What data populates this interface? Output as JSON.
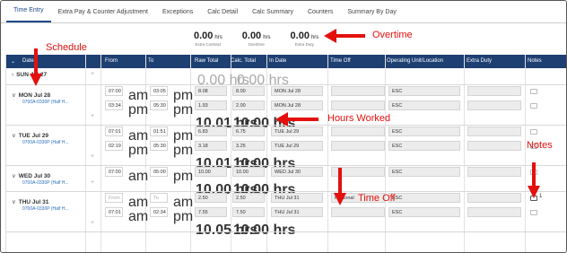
{
  "tabs": [
    "Time Entry",
    "Extra Pay & Counter Adjustment",
    "Exceptions",
    "Calc Detail",
    "Calc Summary",
    "Counters",
    "Summary By Day"
  ],
  "summary": [
    {
      "value": "0.00",
      "unit": "hrs",
      "label": "Extra Contract"
    },
    {
      "value": "0.00",
      "unit": "hrs",
      "label": "Overtime"
    },
    {
      "value": "0.00",
      "unit": "hrs",
      "label": "Extra Duty"
    }
  ],
  "columns": {
    "date": "Date",
    "from": "From",
    "to": "To",
    "raw": "Raw Total",
    "calc": "Calc. Total",
    "indate": "In Date",
    "timeoff": "Time Off",
    "unit": "Operating Unit/Location",
    "extra": "Extra Duty",
    "notes": "Notes"
  },
  "sun": {
    "label": "SUN Jul 27",
    "raw": "0.00 hrs",
    "calc": "0.00 hrs"
  },
  "days": [
    {
      "label": "MON Jul 28",
      "schedule": "0700A-0330P (Half H...",
      "entries": [
        {
          "from": "07:00",
          "from_ampm": "am",
          "to": "03:05",
          "to_ampm": "pm",
          "raw": "8.08",
          "calc": "8.00",
          "indate": "MON Jul 28",
          "timeoff": "",
          "unit": "ESC"
        },
        {
          "from": "03:34",
          "from_ampm": "pm",
          "to": "05:30",
          "to_ampm": "pm",
          "raw": "1.93",
          "calc": "2.00",
          "indate": "MON Jul 28",
          "timeoff": "",
          "unit": "ESC"
        }
      ],
      "raw_total": "10.01 hrs",
      "calc_total": "10.00 hrs"
    },
    {
      "label": "TUE Jul 29",
      "schedule": "0700A-0330P (Half H...",
      "entries": [
        {
          "from": "07:01",
          "from_ampm": "am",
          "to": "01:51",
          "to_ampm": "pm",
          "raw": "6.83",
          "calc": "6.75",
          "indate": "TUE Jul 29",
          "timeoff": "",
          "unit": "ESC"
        },
        {
          "from": "02:19",
          "from_ampm": "pm",
          "to": "05:30",
          "to_ampm": "pm",
          "raw": "3.18",
          "calc": "3.25",
          "indate": "TUE Jul 29",
          "timeoff": "",
          "unit": "ESC"
        }
      ],
      "raw_total": "10.01 hrs",
      "calc_total": "10.00 hrs"
    },
    {
      "label": "WED Jul 30",
      "schedule": "0700A-0330P (Half H...",
      "entries": [
        {
          "from": "07:00",
          "from_ampm": "am",
          "to": "05:00",
          "to_ampm": "pm",
          "raw": "10.00",
          "calc": "10.00",
          "indate": "WED Jul 30",
          "timeoff": "",
          "unit": "ESC"
        }
      ],
      "raw_total": "10.00 hrs",
      "calc_total": "10.00 hrs"
    },
    {
      "label": "THU Jul 31",
      "schedule": "0700A-0330P (Half H...",
      "entries": [
        {
          "from": "From",
          "from_ampm": "am",
          "to": "To",
          "to_ampm": "am",
          "raw": "2.50",
          "calc": "2.50",
          "indate": "THU Jul 31",
          "timeoff": "Personal",
          "unit": "ESC",
          "note_count": "1"
        },
        {
          "from": "07:01",
          "from_ampm": "am",
          "to": "02:34",
          "to_ampm": "pm",
          "raw": "7.55",
          "calc": "7.50",
          "indate": "THU Jul 31",
          "timeoff": "",
          "unit": "ESC"
        }
      ],
      "raw_total": "10.05 hrs",
      "calc_total": "10.00 hrs"
    }
  ],
  "annotations": {
    "schedule": "Schedule",
    "overtime": "Overtime",
    "hours_worked": "Hours Worked",
    "time_off": "Time Off",
    "notes": "Notes"
  },
  "colors": {
    "header": "#1d3f72",
    "annotation": "#e4100e",
    "link": "#2a6fbd"
  }
}
